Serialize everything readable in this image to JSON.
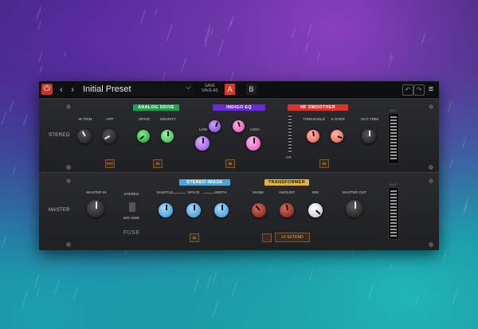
{
  "topbar": {
    "preset_name": "Initial Preset",
    "save_label": "SAVE",
    "save_as_label": "SAVE AS",
    "a_label": "A",
    "b_label": "B",
    "prev": "‹",
    "next": "›",
    "menu": "≡"
  },
  "rack1": {
    "row_label": "STEREO",
    "tags": {
      "analog_drive": "ANALOG DRIVE",
      "indigo_eq": "INDIGO EQ",
      "hf_smoother": "HF SMOOTHER"
    },
    "knobs": {
      "in_trim": "IN TRIM",
      "hpf": "HPF",
      "drive": "DRIVE",
      "density": "DENSITY",
      "low": "LOW",
      "high": "HIGH",
      "threshold": "THRESHOLD",
      "x_over": "X-OVER",
      "out_trim": "OUT TRIM"
    },
    "buttons": {
      "fat": "FAT",
      "in1": "IN",
      "in2": "IN",
      "in3": "IN"
    },
    "gr_label": "GR",
    "out_label": "OUT"
  },
  "rack2": {
    "row_label": "MASTER",
    "tags": {
      "stereo_image": "STEREO IMAGE",
      "transformer": "TRANSFORMER"
    },
    "knobs": {
      "master_in": "MASTER IN",
      "shuffle": "SHUFFLE",
      "space": "SPACE",
      "width": "WIDTH",
      "shine": "SHINE",
      "amount": "AMOUNT",
      "mix": "MIX",
      "master_out": "MASTER OUT"
    },
    "switch": {
      "top": "STEREO",
      "bottom": "M/S SIDE"
    },
    "buttons": {
      "in": "IN",
      "lf_extend": "LF EXTEND"
    },
    "brand": "FUSE",
    "out_label": "OUT"
  },
  "colors": {
    "power": "#c8362a",
    "analog_drive": "#1aa34a",
    "indigo_eq": "#6a2bd6",
    "hf_smoother": "#d9352a",
    "stereo_image": "#4aa7d8",
    "transformer": "#e2b43a"
  }
}
